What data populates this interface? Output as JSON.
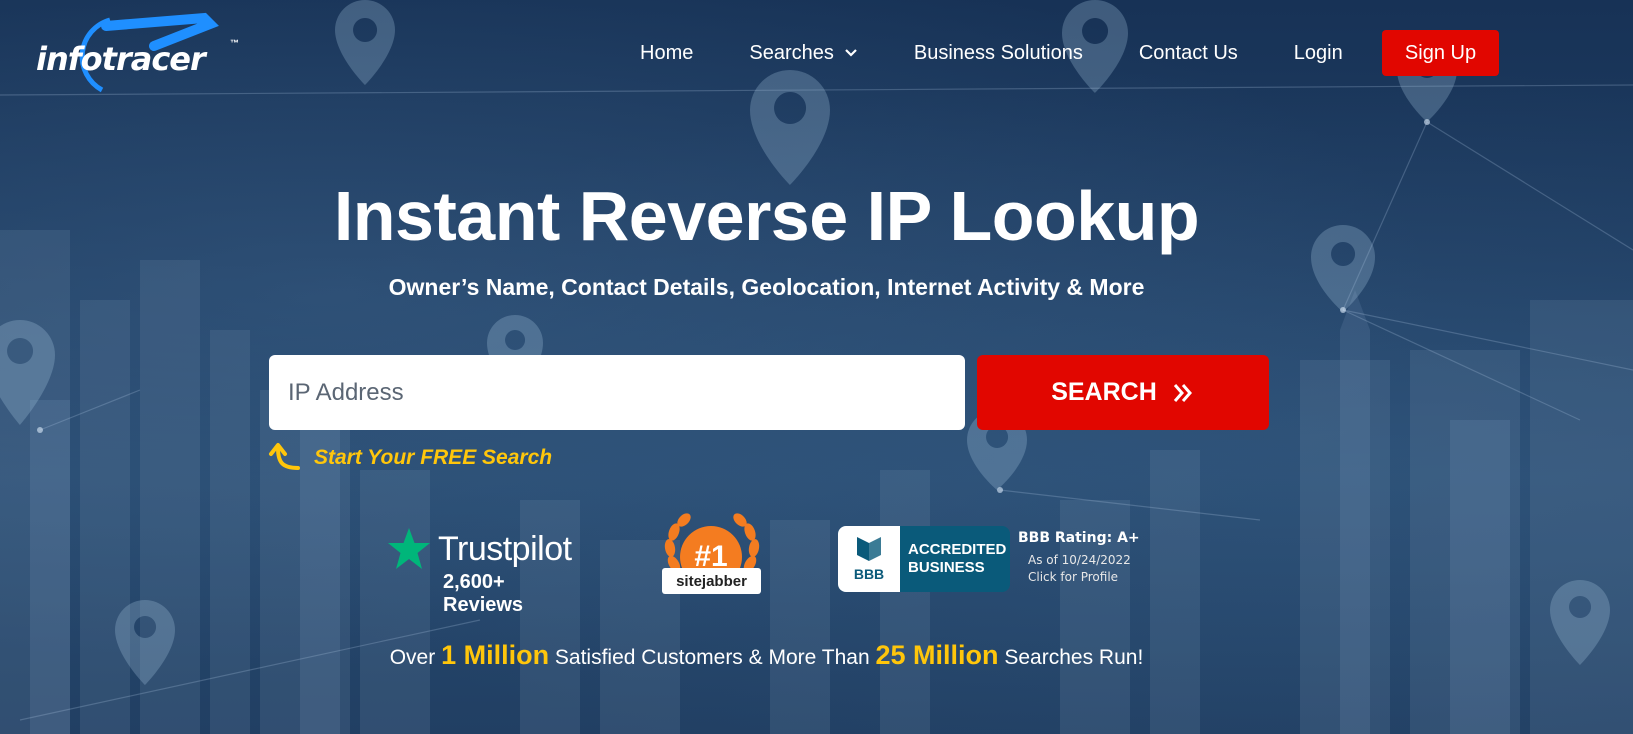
{
  "brand": {
    "logo_text": "infotracer",
    "tm": "™"
  },
  "nav": {
    "items": [
      {
        "label": "Home"
      },
      {
        "label": "Searches"
      },
      {
        "label": "Business Solutions"
      },
      {
        "label": "Contact Us"
      },
      {
        "label": "Login"
      }
    ],
    "signup_label": "Sign Up"
  },
  "hero": {
    "title": "Instant Reverse IP Lookup",
    "subtitle": "Owner’s Name, Contact Details, Geolocation, Internet Activity & More",
    "search_placeholder": "IP Address",
    "search_button": "SEARCH",
    "free_search": "Start Your FREE Search"
  },
  "badges": {
    "trustpilot": {
      "name": "Trustpilot",
      "reviews": "2,600+ Reviews"
    },
    "sitejabber": {
      "rank": "#1",
      "name": "sitejabber"
    },
    "bbb": {
      "logo": "BBB",
      "line1": "ACCREDITED",
      "line2": "BUSINESS",
      "rating": "BBB Rating: A+",
      "date": "As of 10/24/2022",
      "click": "Click for Profile"
    }
  },
  "stats": {
    "prefix": "Over",
    "customers": "1 Million",
    "middle": "Satisfied Customers & More Than",
    "searches": "25 Million",
    "suffix": "Searches Run!"
  },
  "colors": {
    "accent_red": "#e10600",
    "highlight_yellow": "#ffc60b",
    "background_navy": "#1d3a5e",
    "bbb_teal": "#0a5a7a",
    "trustpilot_green": "#00b67a",
    "sitejabber_orange": "#f47c20"
  },
  "icons": [
    "chevron-down-icon",
    "double-chevron-right-icon",
    "curved-arrow-icon",
    "trustpilot-star-icon",
    "laurel-icon",
    "bbb-torch-icon",
    "map-pin-icon"
  ]
}
